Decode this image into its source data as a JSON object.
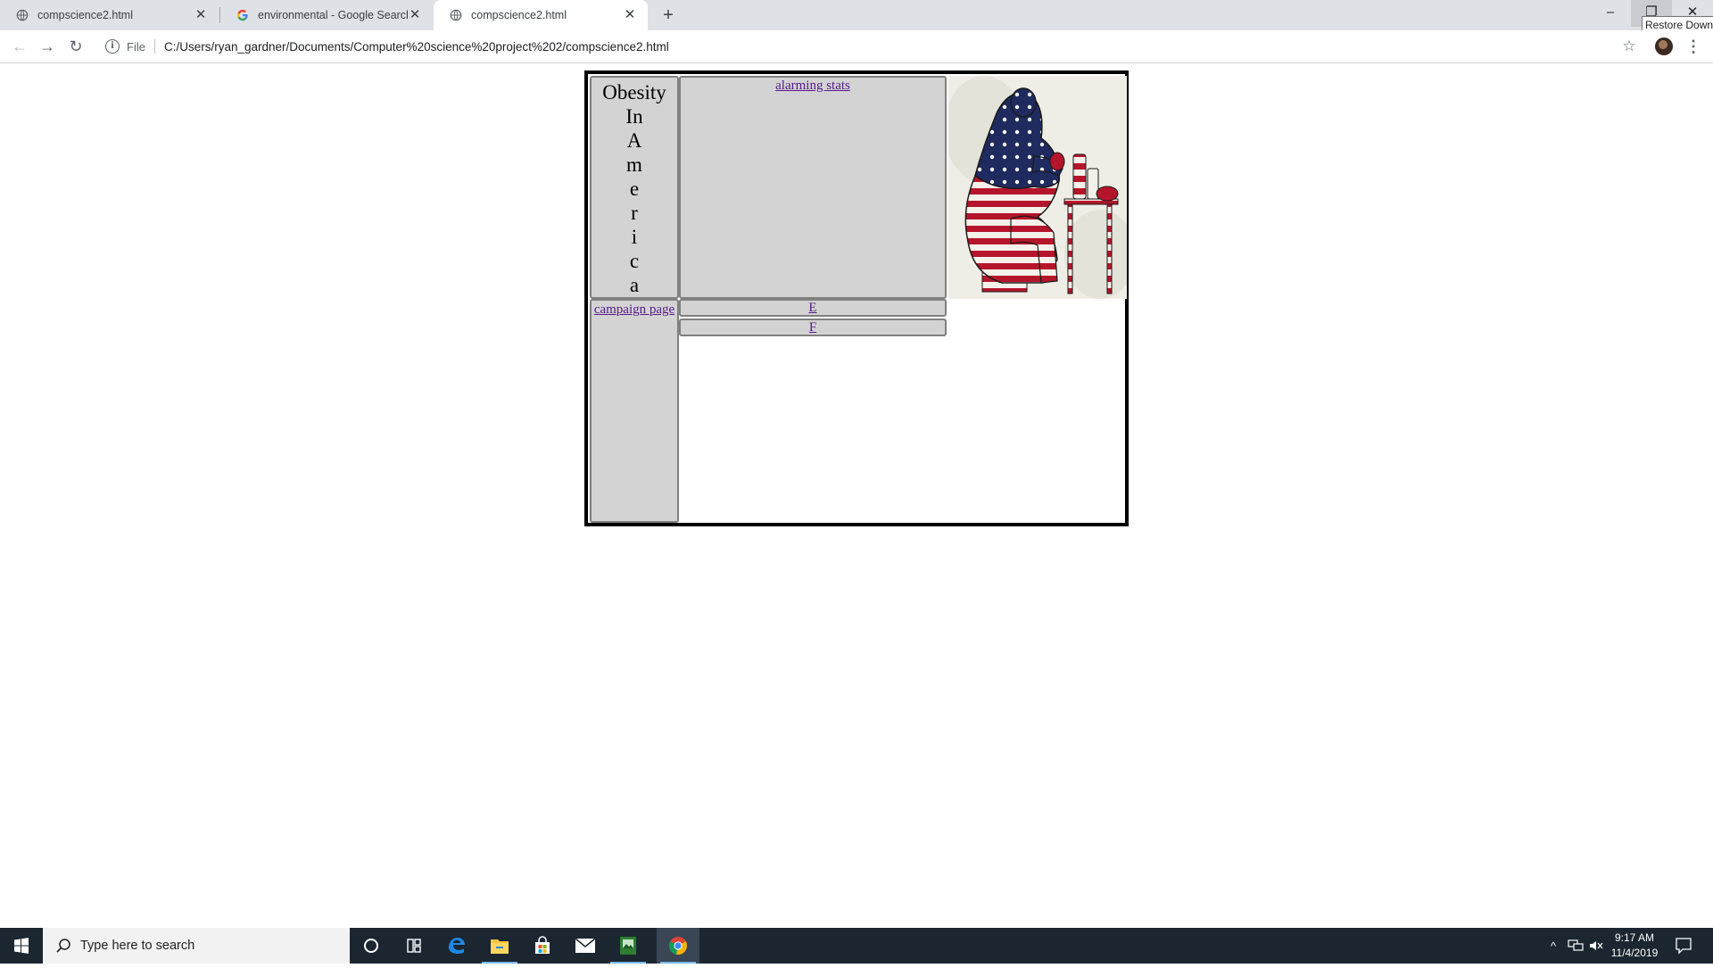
{
  "browser": {
    "tabs": [
      {
        "title": "compscience2.html",
        "active": false,
        "favicon": "globe-icon"
      },
      {
        "title": "environmental - Google Search",
        "active": false,
        "favicon": "google-g-icon"
      },
      {
        "title": "compscience2.html",
        "active": true,
        "favicon": "globe-icon"
      }
    ],
    "new_tab_glyph": "+",
    "window_controls": {
      "minimize": "–",
      "restore": "❐",
      "close": "✕"
    },
    "tooltip": "Restore Down",
    "toolbar": {
      "back": "←",
      "forward": "→",
      "reload": "↻",
      "info_glyph": "i",
      "scheme_chip": "File",
      "url": "C:/Users/ryan_gardner/Documents/Computer%20science%20project%202/compscience2.html",
      "star": "☆",
      "menu": "⋮"
    }
  },
  "page": {
    "title_lines": [
      "Obesity",
      "In",
      "A",
      "m",
      "e",
      "r",
      "i",
      "c",
      "a"
    ],
    "links": {
      "alarming_stats": "alarming stats",
      "campaign_page": "campaign page",
      "e": "E",
      "f": "F"
    },
    "image_subject": "flag-patterned seated figure at a table"
  },
  "taskbar": {
    "search_placeholder": "Type here to search",
    "pinned_apps": [
      "cortana-icon",
      "task-view-icon",
      "edge-icon",
      "file-explorer-icon",
      "store-icon",
      "mail-icon",
      "image-app-icon",
      "chrome-icon"
    ],
    "tray": {
      "chevron": "^",
      "time": "9:17 AM",
      "date": "11/4/2019"
    }
  },
  "colors": {
    "tabstrip": "#dee1e6",
    "cell_gray": "#d3d3d3",
    "visited_link": "#551a8b",
    "taskbar": "#1b2631"
  }
}
